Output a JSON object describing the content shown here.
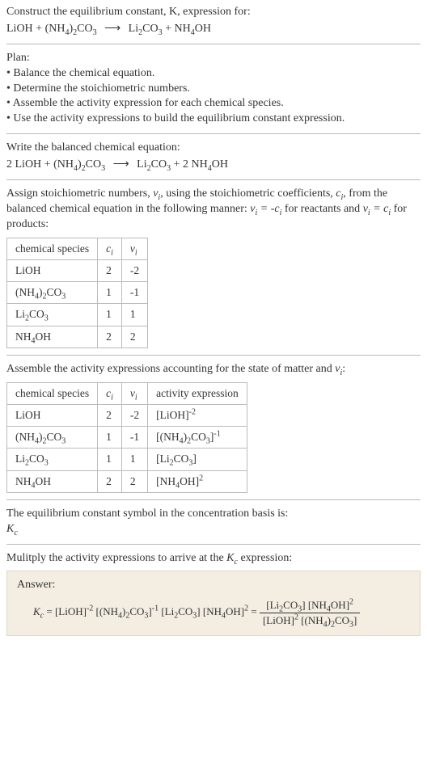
{
  "s1": {
    "line1": "Construct the equilibrium constant, K, expression for:",
    "eq_lhs_a": "LiOH",
    "eq_plus1": "+",
    "eq_lhs_b": "(NH",
    "eq_lhs_b2": ")",
    "eq_lhs_b3": "CO",
    "eq_rhs_a": "Li",
    "eq_rhs_a2": "CO",
    "eq_plus2": "+",
    "eq_rhs_b": "NH",
    "eq_rhs_b2": "OH"
  },
  "s2": {
    "head": "Plan:",
    "b1": "• Balance the chemical equation.",
    "b2": "• Determine the stoichiometric numbers.",
    "b3": "• Assemble the activity expression for each chemical species.",
    "b4": "• Use the activity expressions to build the equilibrium constant expression."
  },
  "s3": {
    "head": "Write the balanced chemical equation:",
    "c1": "2",
    "c2": "2"
  },
  "s4": {
    "line1a": "Assign stoichiometric numbers, ",
    "line1b": ", using the stoichiometric coefficients, ",
    "line1c": ", from the balanced chemical equation in the following manner: ",
    "line1d": " for reactants and ",
    "line1e": " for products:",
    "th1": "chemical species",
    "r1c1": "LiOH",
    "r1c2": "2",
    "r1c3": "-2",
    "r2c1_a": "(NH",
    "r2c1_b": ")",
    "r2c1_c": "CO",
    "r2c2": "1",
    "r2c3": "-1",
    "r3c1_a": "Li",
    "r3c1_b": "CO",
    "r3c2": "1",
    "r3c3": "1",
    "r4c1_a": "NH",
    "r4c1_b": "OH",
    "r4c2": "2",
    "r4c3": "2"
  },
  "s5": {
    "head": "Assemble the activity expressions accounting for the state of matter and ",
    "th1": "chemical species",
    "th4": "activity expression",
    "r1a": "[LiOH]",
    "r2a": "[(NH",
    "r2b": ")",
    "r2c": "CO",
    "r2d": "]",
    "r3a": "[Li",
    "r3b": "CO",
    "r3c": "]",
    "r4a": "[NH",
    "r4b": "OH]"
  },
  "s6": {
    "l1": "The equilibrium constant symbol in the concentration basis is:",
    "sym": "K"
  },
  "s7": {
    "l1": "Mulitply the activity expressions to arrive at the ",
    "l2": " expression:"
  },
  "ans": {
    "label": "Answer:",
    "eqsym": "K",
    "eq": " = [LiOH]",
    "t1": " [(NH",
    "t1b": ")",
    "t1c": "CO",
    "t1d": "]",
    "t2": " [Li",
    "t2b": "CO",
    "t2c": "]",
    "t3": " [NH",
    "t3b": "OH]",
    "eqeq": " = ",
    "numA": "[Li",
    "numA2": "CO",
    "numA3": "] [NH",
    "numA4": "OH]",
    "denA": "[LiOH]",
    "denB": " [(NH",
    "denB2": ")",
    "denB3": "CO",
    "denB4": "]"
  },
  "chart_data": {
    "type": "table",
    "tables": [
      {
        "title": "stoichiometric numbers",
        "columns": [
          "chemical species",
          "c_i",
          "v_i"
        ],
        "rows": [
          [
            "LiOH",
            2,
            -2
          ],
          [
            "(NH4)2CO3",
            1,
            -1
          ],
          [
            "Li2CO3",
            1,
            1
          ],
          [
            "NH4OH",
            2,
            2
          ]
        ]
      },
      {
        "title": "activity expressions",
        "columns": [
          "chemical species",
          "c_i",
          "v_i",
          "activity expression"
        ],
        "rows": [
          [
            "LiOH",
            2,
            -2,
            "[LiOH]^-2"
          ],
          [
            "(NH4)2CO3",
            1,
            -1,
            "[(NH4)2CO3]^-1"
          ],
          [
            "Li2CO3",
            1,
            1,
            "[Li2CO3]"
          ],
          [
            "NH4OH",
            2,
            2,
            "[NH4OH]^2"
          ]
        ]
      }
    ]
  }
}
